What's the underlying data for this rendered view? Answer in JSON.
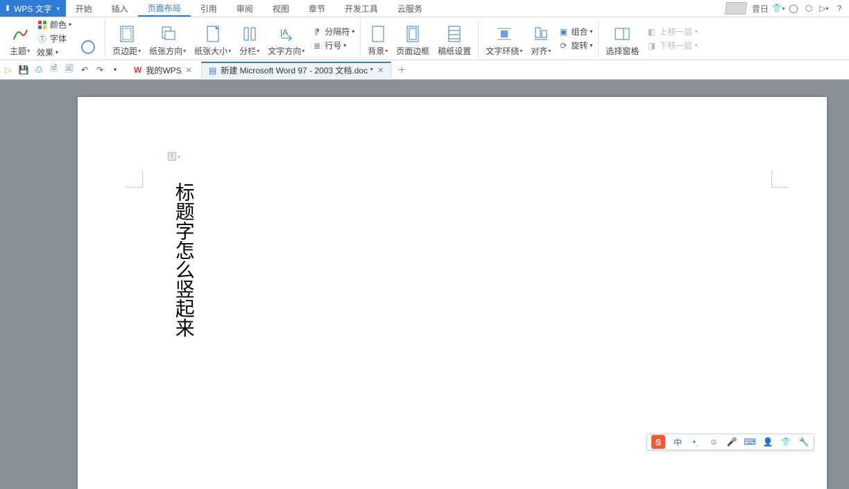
{
  "app": {
    "brand": "WPS 文字"
  },
  "menu": {
    "items": [
      "开始",
      "插入",
      "页面布局",
      "引用",
      "审阅",
      "视图",
      "章节",
      "开发工具",
      "云服务"
    ],
    "active_index": 2
  },
  "titlebar_right": {
    "username": "昔日"
  },
  "ribbon": {
    "theme": "主题",
    "color": "颜色",
    "font_effect_t": "字体",
    "font_effect_e": "效果",
    "margins": "页边距",
    "orientation": "纸张方向",
    "size": "纸张大小",
    "columns": "分栏",
    "text_direction": "文字方向",
    "line_numbers": "行号",
    "separator": "分隔符",
    "background": "背景",
    "page_border": "页面边框",
    "draft_paper": "稿纸设置",
    "text_wrap": "文字环绕",
    "align": "对齐",
    "rotate": "旋转",
    "select_pane": "选择窗格",
    "group": "组合",
    "move_up": "上移一层",
    "move_down": "下移一层"
  },
  "tabs": {
    "home": "我的WPS",
    "doc": "新建 Microsoft Word 97 - 2003 文档.doc *"
  },
  "document": {
    "vertical_title": "标题字怎么竖起来"
  },
  "ime": {
    "lang": "中"
  }
}
